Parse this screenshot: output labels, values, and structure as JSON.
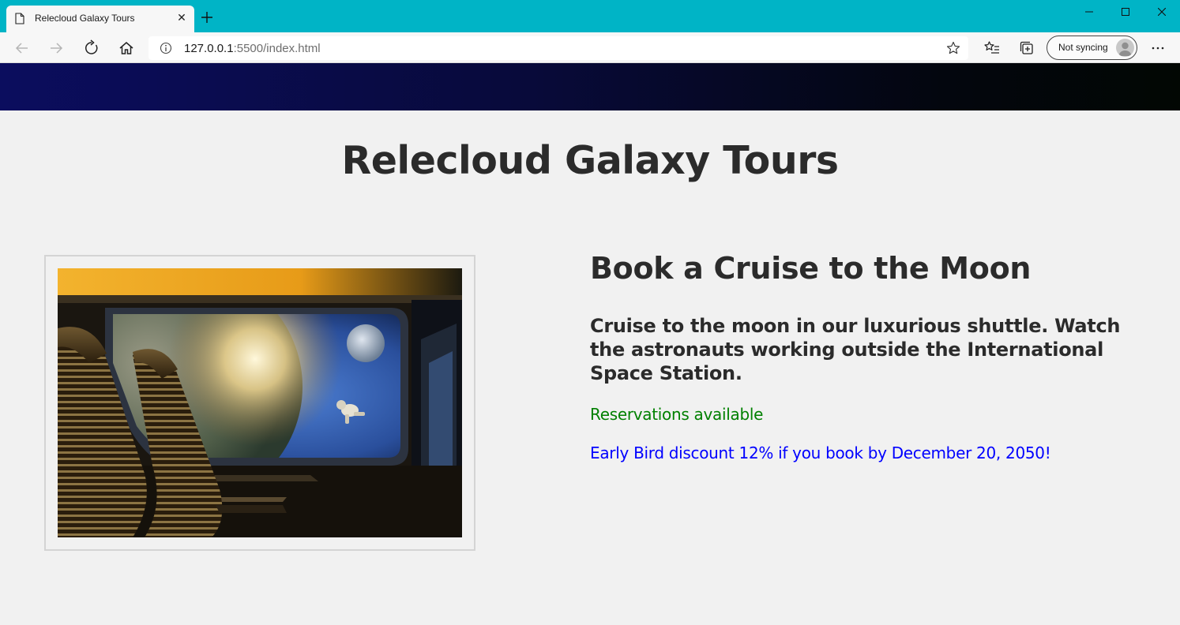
{
  "browser": {
    "tab_title": "Relecloud Galaxy Tours",
    "url_host": "127.0.0.1",
    "url_rest": ":5500/index.html",
    "sync_label": "Not syncing",
    "icons": [
      "page-icon",
      "close-icon",
      "plus-icon",
      "minimize-icon",
      "maximize-icon",
      "close-window-icon",
      "back-arrow-icon",
      "forward-arrow-icon",
      "refresh-icon",
      "home-icon",
      "info-icon",
      "star-icon",
      "favorites-icon",
      "collections-icon",
      "avatar-icon",
      "more-icon"
    ],
    "colors": {
      "titlebar": "#00b4c6",
      "toolbar": "#f7f7f7"
    }
  },
  "page": {
    "title": "Relecloud Galaxy Tours",
    "tour": {
      "heading": "Book a Cruise to the Moon",
      "description": "Cruise to the moon in our luxurious shuttle. Watch the astronauts working outside the International Space Station.",
      "availability": "Reservations available",
      "discount": "Early Bird discount 12% if you book by December 20, 2050!"
    },
    "colors": {
      "background": "#f1f1f1",
      "text": "#2b2b2b",
      "availability": "#008000",
      "discount": "#0000ff"
    }
  }
}
